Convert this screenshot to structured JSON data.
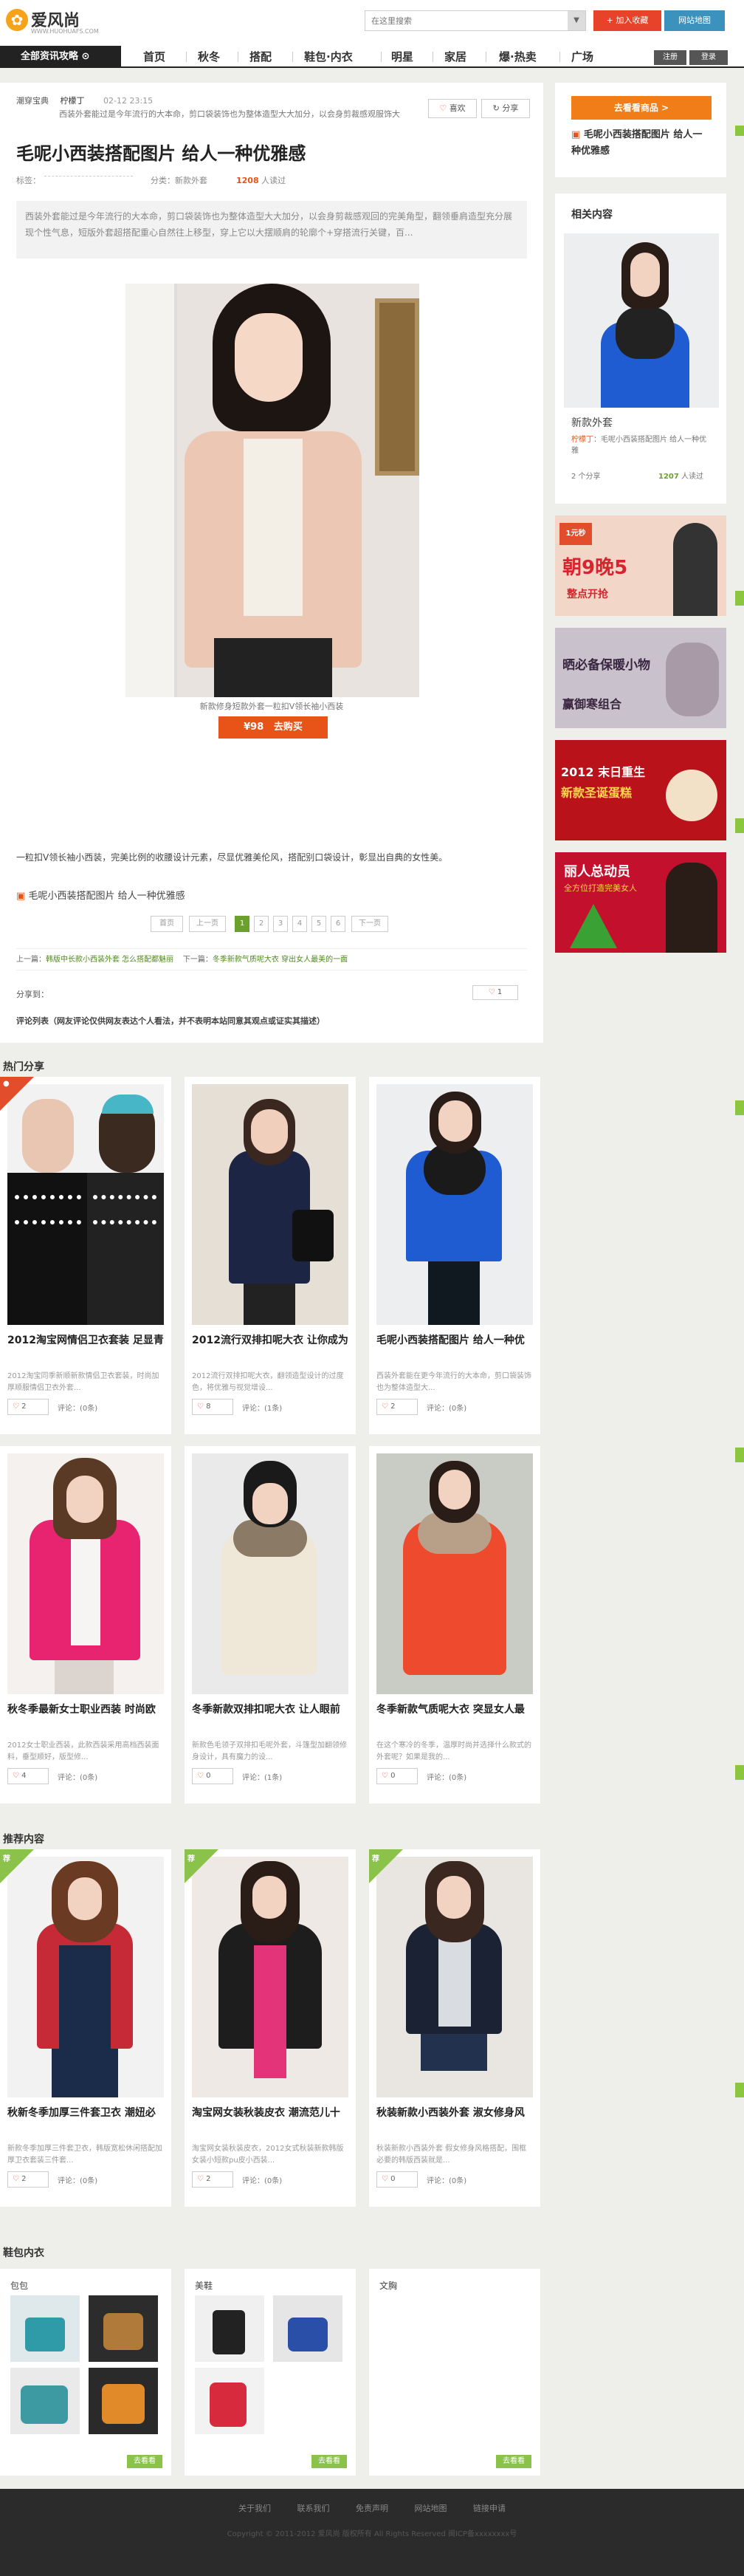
{
  "header": {
    "logo_text": "爱风尚",
    "logo_url": "WWW.HUOHUAFS.COM",
    "search_placeholder": "在这里搜索",
    "search_btn": "▼",
    "fav_label": "+ 加入收藏",
    "map_label": "网站地图"
  },
  "nav": {
    "category": "全部资讯攻略",
    "items": [
      "首页",
      "秋冬",
      "搭配",
      "鞋包·内衣",
      "明星",
      "家居",
      "爆·热卖",
      "广场"
    ],
    "login": "注册",
    "register": "登录"
  },
  "article": {
    "source": "潮穿宝典",
    "author": "柠檬丁",
    "date": "02-12 23:15",
    "snippet": "西装外套能过是今年流行的大本命，剪口袋装饰也为整体造型大大加分，以会身剪裁感观服饰大",
    "like_label": "喜欢",
    "share_label": "分享",
    "title": "毛呢小西装搭配图片 给人一种优雅感",
    "tag_label": "标签：",
    "category_label": "分类：新款外套",
    "views": "1208",
    "views_label": "人读过",
    "summary": "西装外套能过是今年流行的大本命，剪口袋装饰也为整体造型大大加分，以会身剪裁感观回的完美角型，翻领垂肩造型充分展现个性气息，短版外套超搭配重心自然往上移型，穿上它以大摆顺肩的轮廓个+穿搭流行关键，百...",
    "caption": "新款修身短款外套一粒扣V领长袖小西装",
    "price": "¥98",
    "buy_label": "去购买",
    "body": "一粒扣V领长袖小西装，完美比例的收腰设计元素，尽显优雅美伦风，搭配别口袋设计，彰显出自典的女性美。",
    "link_text": "毛呢小西装搭配图片 给人一种优雅感",
    "pager": [
      "首页",
      "上一页",
      "1",
      "2",
      "3",
      "4",
      "5",
      "6",
      "下一页"
    ],
    "prev_label": "上一篇：",
    "prev_text": "韩版中长款小西装外套 怎么搭配都魅丽",
    "next_label": "下一篇：",
    "next_text": "冬季新款气质呢大衣 穿出女人最美的一面",
    "share_to": "分享到：",
    "like_count": "1",
    "comment_title": "评论列表",
    "comment_note": "（网友评论仅供网友表达个人看法，并不表明本站同意其观点或证实其描述）"
  },
  "sidebar": {
    "cta": "去看看商品 >",
    "link_title": "毛呢小西装搭配图片 给人一种优雅感",
    "related_title": "相关内容",
    "related_caption": "新款外套",
    "related_author": "柠檬丁",
    "related_desc": "毛呢小西装搭配图片 给人一种优雅",
    "related_share": "2 个分享",
    "related_views": "1207",
    "related_views_label": "人读过",
    "ads": [
      {
        "big": "朝9晚5",
        "small": "整点开抢",
        "badge": "1元秒"
      },
      {
        "big": "晒必备保暖小物",
        "small": "赢御寒组合"
      },
      {
        "big": "2012 末日重生",
        "small": "新款圣诞蛋糕"
      },
      {
        "big": "丽人总动员",
        "small": "全方位打造完美女人"
      }
    ]
  },
  "hot": {
    "title": "热门分享",
    "cards": [
      {
        "title": "2012淘宝网情侣卫衣套装 足显青",
        "desc": "2012淘宝同季新顺新款情侣卫衣套装，时尚加厚顺服情侣卫衣外套...",
        "likes": "2",
        "comments": "评论：(0条)"
      },
      {
        "title": "2012流行双排扣呢大衣 让你成为",
        "desc": "2012流行双排扣呢大衣，翻领造型设计的过度色，将优雅与视觉增设...",
        "likes": "8",
        "comments": "评论：(1条)"
      },
      {
        "title": "毛呢小西装搭配图片 给人一种优",
        "desc": "西装外套能在更今年流行的大本命，剪口袋装饰也为整体造型大...",
        "likes": "2",
        "comments": "评论：(0条)"
      },
      {
        "title": "秋冬季最新女士职业西装 时尚欧",
        "desc": "2012女士职业西装，此款西装采用高档西装面料，垂型顺好，版型修...",
        "likes": "4",
        "comments": "评论：(0条)"
      },
      {
        "title": "冬季新款双排扣呢大衣 让人眼前",
        "desc": "新款色毛领子双排扣毛呢外套，斗篷型加翻领修身设计，具有魔力的设...",
        "likes": "0",
        "comments": "评论：(1条)"
      },
      {
        "title": "冬季新款气质呢大衣 突显女人最",
        "desc": "在这个寒冷的冬季，温厚时尚并选择什么款式的外套呢？如果是我的...",
        "likes": "0",
        "comments": "评论：(0条)"
      }
    ]
  },
  "recommend": {
    "title": "推荐内容",
    "tag": "荐",
    "cards": [
      {
        "title": "秋新冬季加厚三件套卫衣 潮妞必",
        "desc": "新款冬季加厚三件套卫衣，韩版宽松休闲搭配加厚卫衣套装三件套...",
        "likes": "2",
        "comments": "评论：(0条)"
      },
      {
        "title": "淘宝网女装秋装皮衣 潮流范儿十",
        "desc": "淘宝网女装秋装皮衣，2012女式秋装新款韩版女装小短款pu皮小西装...",
        "likes": "2",
        "comments": "评论：(0条)"
      },
      {
        "title": "秋装新款小西装外套 淑女修身风",
        "desc": "秋装新款小西装外套 假女修身风格搭配，围框必要的韩版西装就是...",
        "likes": "0",
        "comments": "评论：(0条)"
      }
    ]
  },
  "bags": {
    "title": "鞋包内衣",
    "panels": [
      "包包",
      "美鞋",
      "文胸"
    ],
    "more": "去看看"
  },
  "footer": {
    "links": [
      "关于我们",
      "联系我们",
      "免责声明",
      "网站地图",
      "链接申请"
    ],
    "copy": "Copyright © 2011-2012 爱风尚 版权所有 All Rights Reserved 闽ICP备xxxxxxxx号"
  },
  "colors": {
    "accent": "#6aa12a",
    "orange": "#f07d18",
    "red": "#e24d2b",
    "dark": "#222222"
  }
}
